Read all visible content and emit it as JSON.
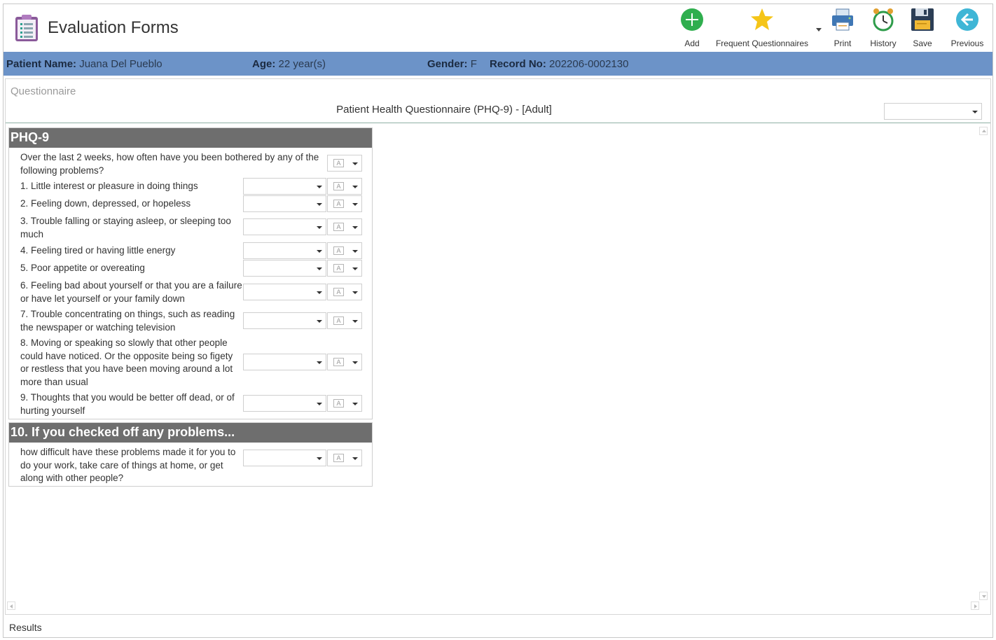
{
  "app": {
    "title": "Evaluation Forms"
  },
  "toolbar": {
    "add": "Add",
    "frequent": "Frequent Questionnaires",
    "print": "Print",
    "history": "History",
    "save": "Save",
    "previous": "Previous"
  },
  "colors": {
    "patient_bar": "#6c93c8",
    "group_header": "#6e6e6e",
    "add_green": "#2fae4e",
    "star_yellow": "#f5c518",
    "previous_teal": "#3fb6d6"
  },
  "patient": {
    "name_label": "Patient Name:",
    "name": "Juana Del Pueblo",
    "age_label": "Age:",
    "age": "22 year(s)",
    "gender_label": "Gender:",
    "gender": "F",
    "record_label": "Record No:",
    "record": "202206-0002130"
  },
  "main": {
    "caption": "Questionnaire",
    "form_title": "Patient Health Questionnaire (PHQ-9) - [Adult]",
    "top_select_value": ""
  },
  "groups": [
    {
      "title": "PHQ-9",
      "intro": "Over the last 2 weeks, how often have you been bothered by any of the following problems?",
      "questions": [
        "1. Little interest or pleasure in doing things",
        "2. Feeling down, depressed, or hopeless",
        "3. Trouble falling or staying asleep, or sleeping too much",
        "4. Feeling tired or having little energy",
        "5. Poor appetite or overeating",
        "6. Feeling bad about yourself or that you are a failure or have let yourself or your family down",
        "7. Trouble concentrating on things, such as reading the newspaper or watching television",
        "8. Moving or speaking so slowly that other people could have noticed. Or the opposite being so figety or restless that you have been moving around a lot more than usual",
        "9. Thoughts that you would be better off dead, or of hurting yourself"
      ]
    },
    {
      "title": "10. If you checked off any problems...",
      "questions": [
        "how difficult have these problems made it for you to do your work, take care of things at home, or get along with other people?"
      ]
    }
  ],
  "footer": {
    "results": "Results"
  }
}
